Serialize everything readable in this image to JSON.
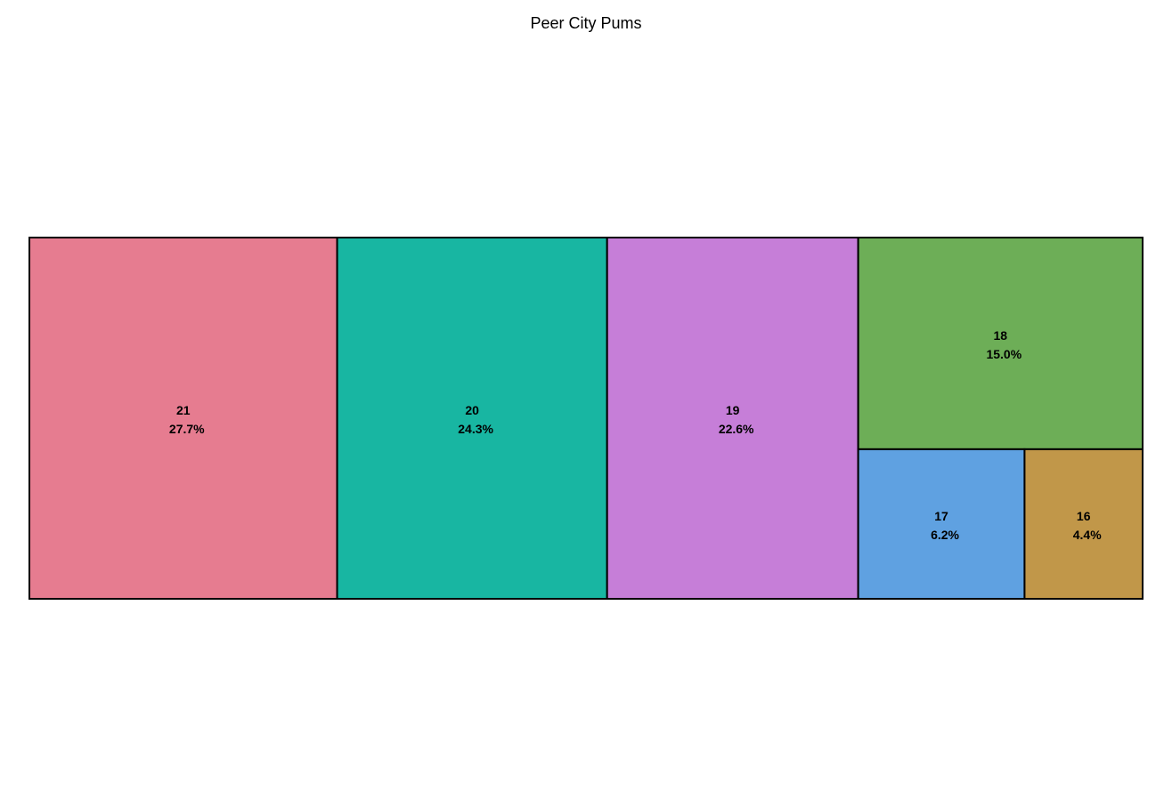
{
  "chart_data": {
    "type": "treemap",
    "title": "Peer City Pums",
    "items": [
      {
        "label": "21",
        "share_label": "27.7%",
        "value": 27.7,
        "color": "#E67C90"
      },
      {
        "label": "20",
        "share_label": "24.3%",
        "value": 24.3,
        "color": "#18B6A2"
      },
      {
        "label": "19",
        "share_label": "22.6%",
        "value": 22.6,
        "color": "#C67ED8"
      },
      {
        "label": "18",
        "share_label": "15.0%",
        "value": 15.0,
        "color": "#6DAE57"
      },
      {
        "label": "17",
        "share_label": "6.2%",
        "value": 6.2,
        "color": "#5FA1E1"
      },
      {
        "label": "16",
        "share_label": "4.4%",
        "value": 4.4,
        "color": "#C19749"
      }
    ]
  }
}
